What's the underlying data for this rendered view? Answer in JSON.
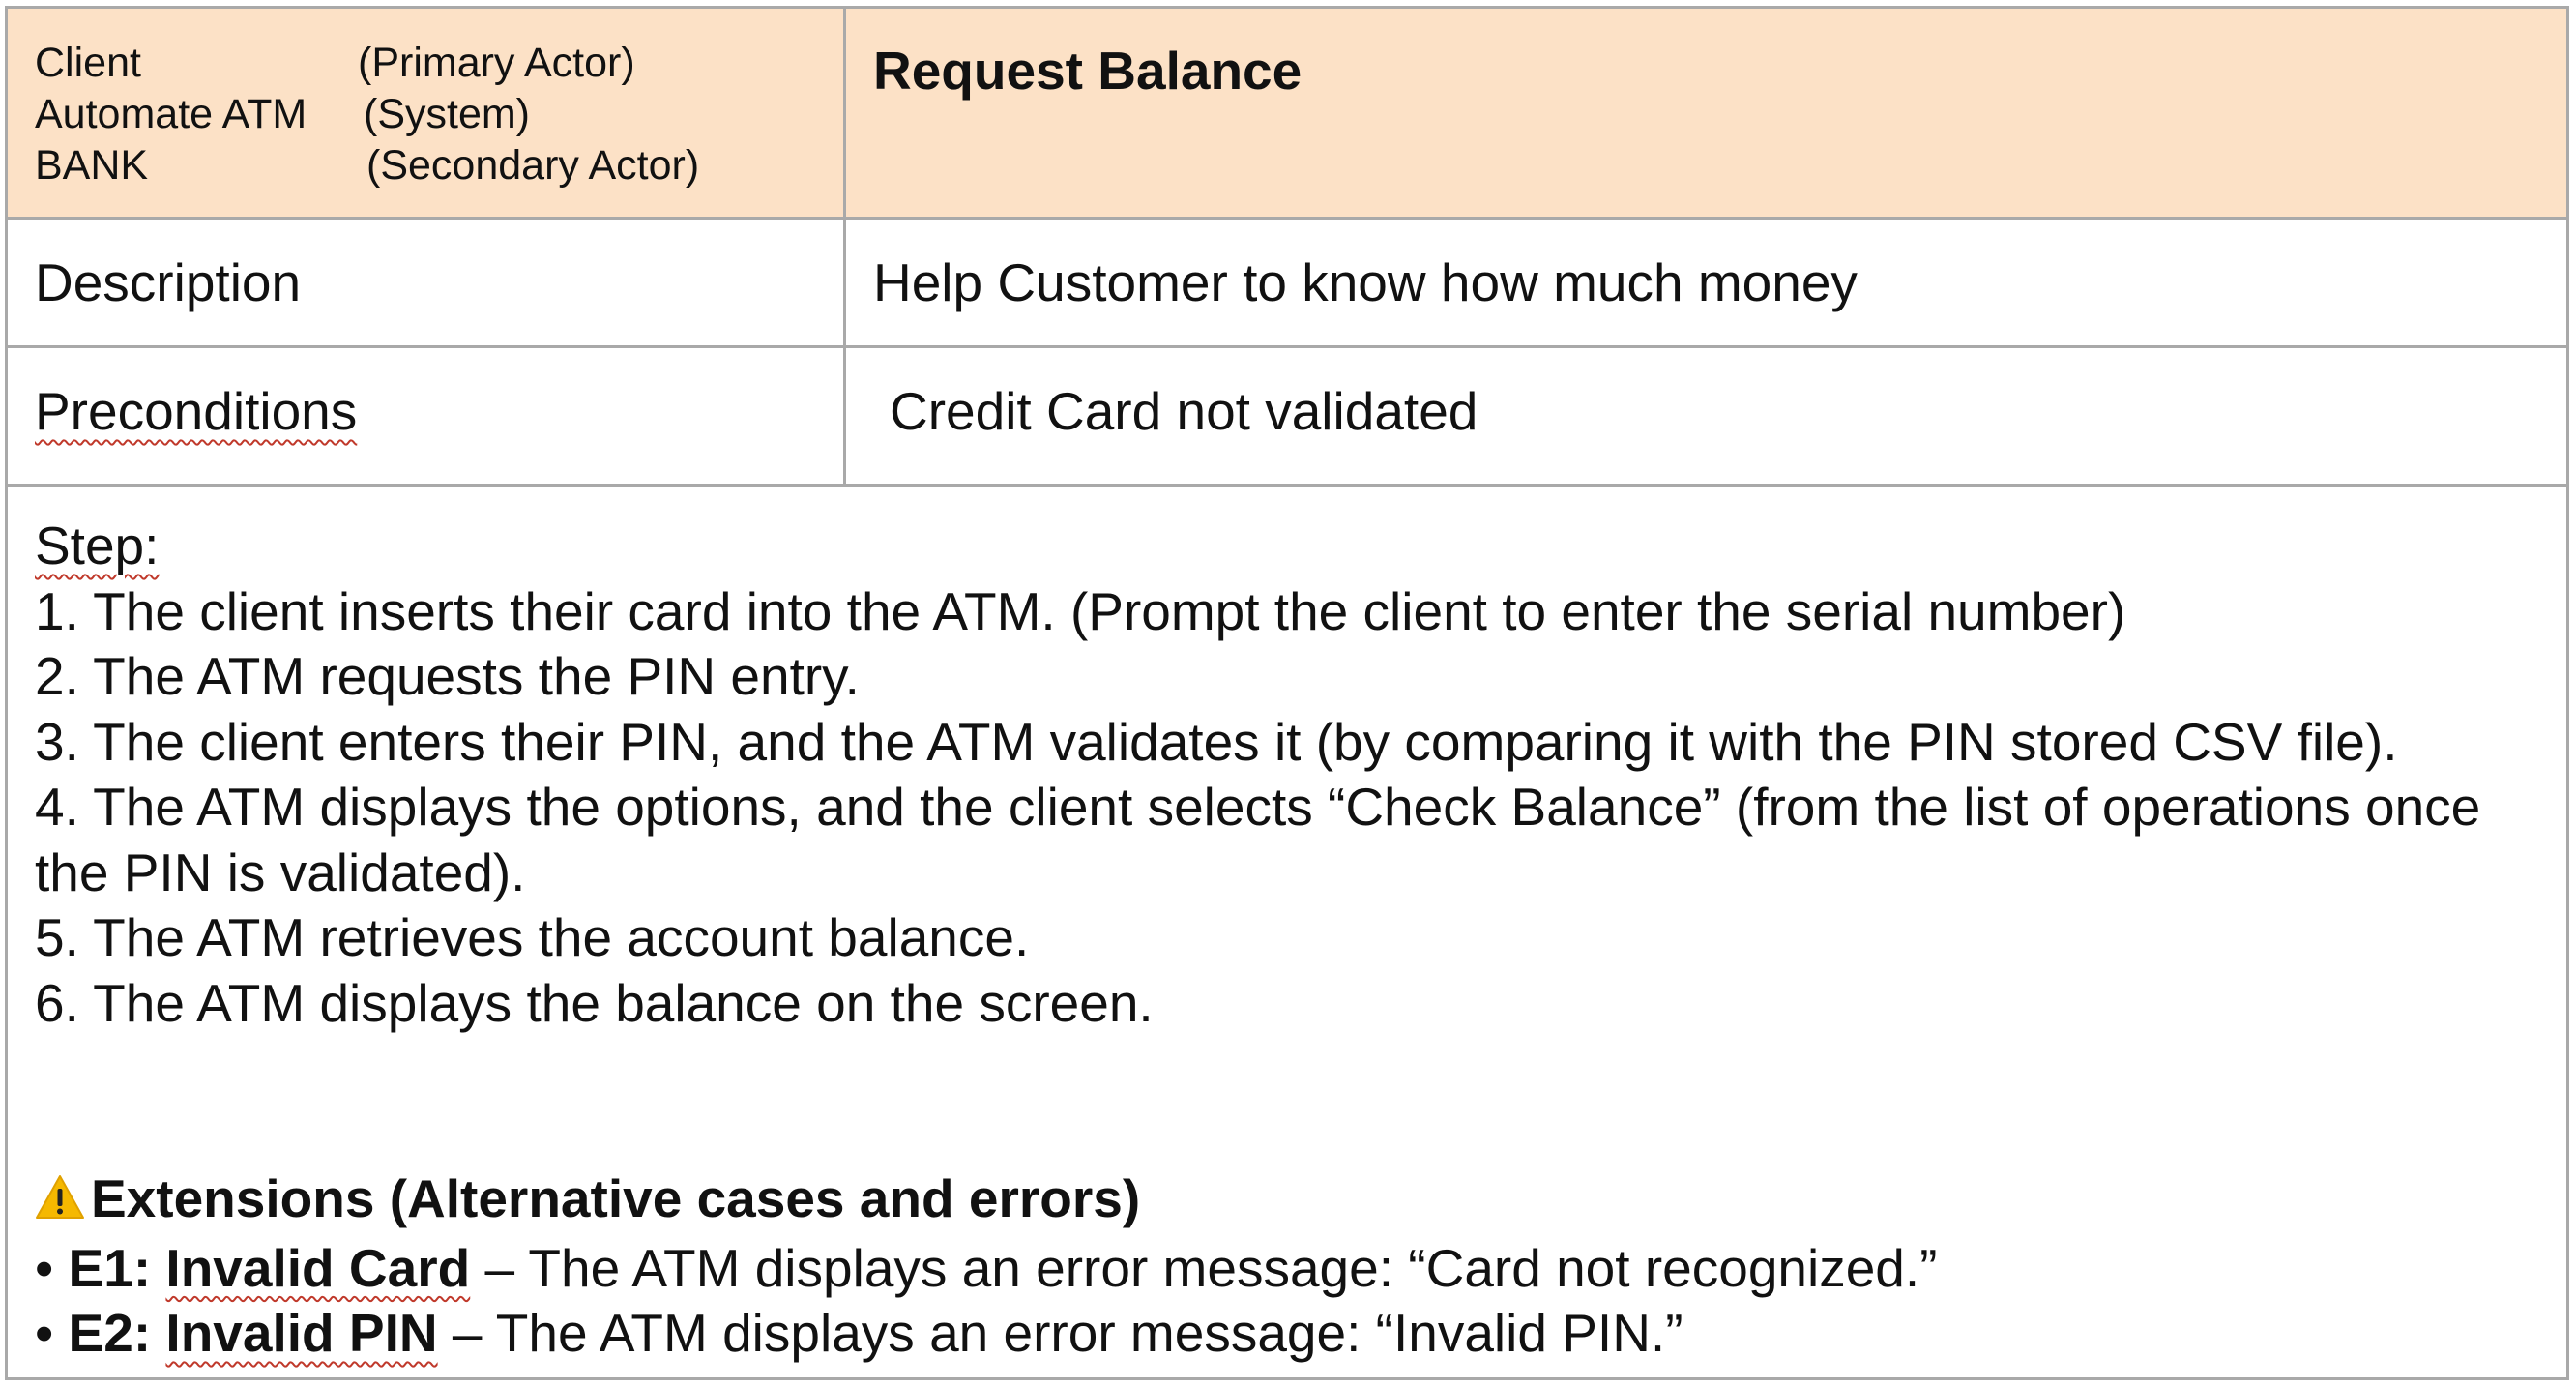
{
  "header": {
    "actors": [
      {
        "name": "Client",
        "role": "(Primary Actor)"
      },
      {
        "name": "Automate ATM",
        "role": "(System)"
      },
      {
        "name": "BANK",
        "role": "(Secondary Actor)"
      }
    ],
    "title": "Request Balance"
  },
  "description": {
    "label": "Description",
    "value": "Help Customer to know how much money"
  },
  "preconditions": {
    "label": "Preconditions",
    "value": "Credit Card not validated"
  },
  "steps": {
    "heading": "Step:",
    "items": [
      "1. The client inserts their card into the ATM. (Prompt the client to enter the serial number)",
      "2. The ATM requests the PIN entry.",
      "3. The client enters their PIN, and the ATM validates it (by comparing it with the PIN stored CSV file).",
      "4. The ATM displays the options, and the client selects “Check Balance” (from the list of operations once the PIN is validated).",
      "5. The ATM retrieves the account balance.",
      "6. The ATM displays the balance on the screen."
    ]
  },
  "extensions": {
    "icon": "warning-icon",
    "icon_color": "#f5b800",
    "heading": "Extensions (Alternative cases and errors)",
    "items": [
      {
        "bullet": "•",
        "code": "E1:",
        "name": "Invalid Card",
        "text": " – The ATM displays an error message: “Card not recognized.”"
      },
      {
        "bullet": "•",
        "code": "E2:",
        "name": "Invalid PIN",
        "text": " – The ATM displays an error message: “Invalid PIN.”"
      }
    ]
  },
  "colors": {
    "header_background": "#fce1c6",
    "border": "#a9a9a9",
    "text": "#111111"
  }
}
